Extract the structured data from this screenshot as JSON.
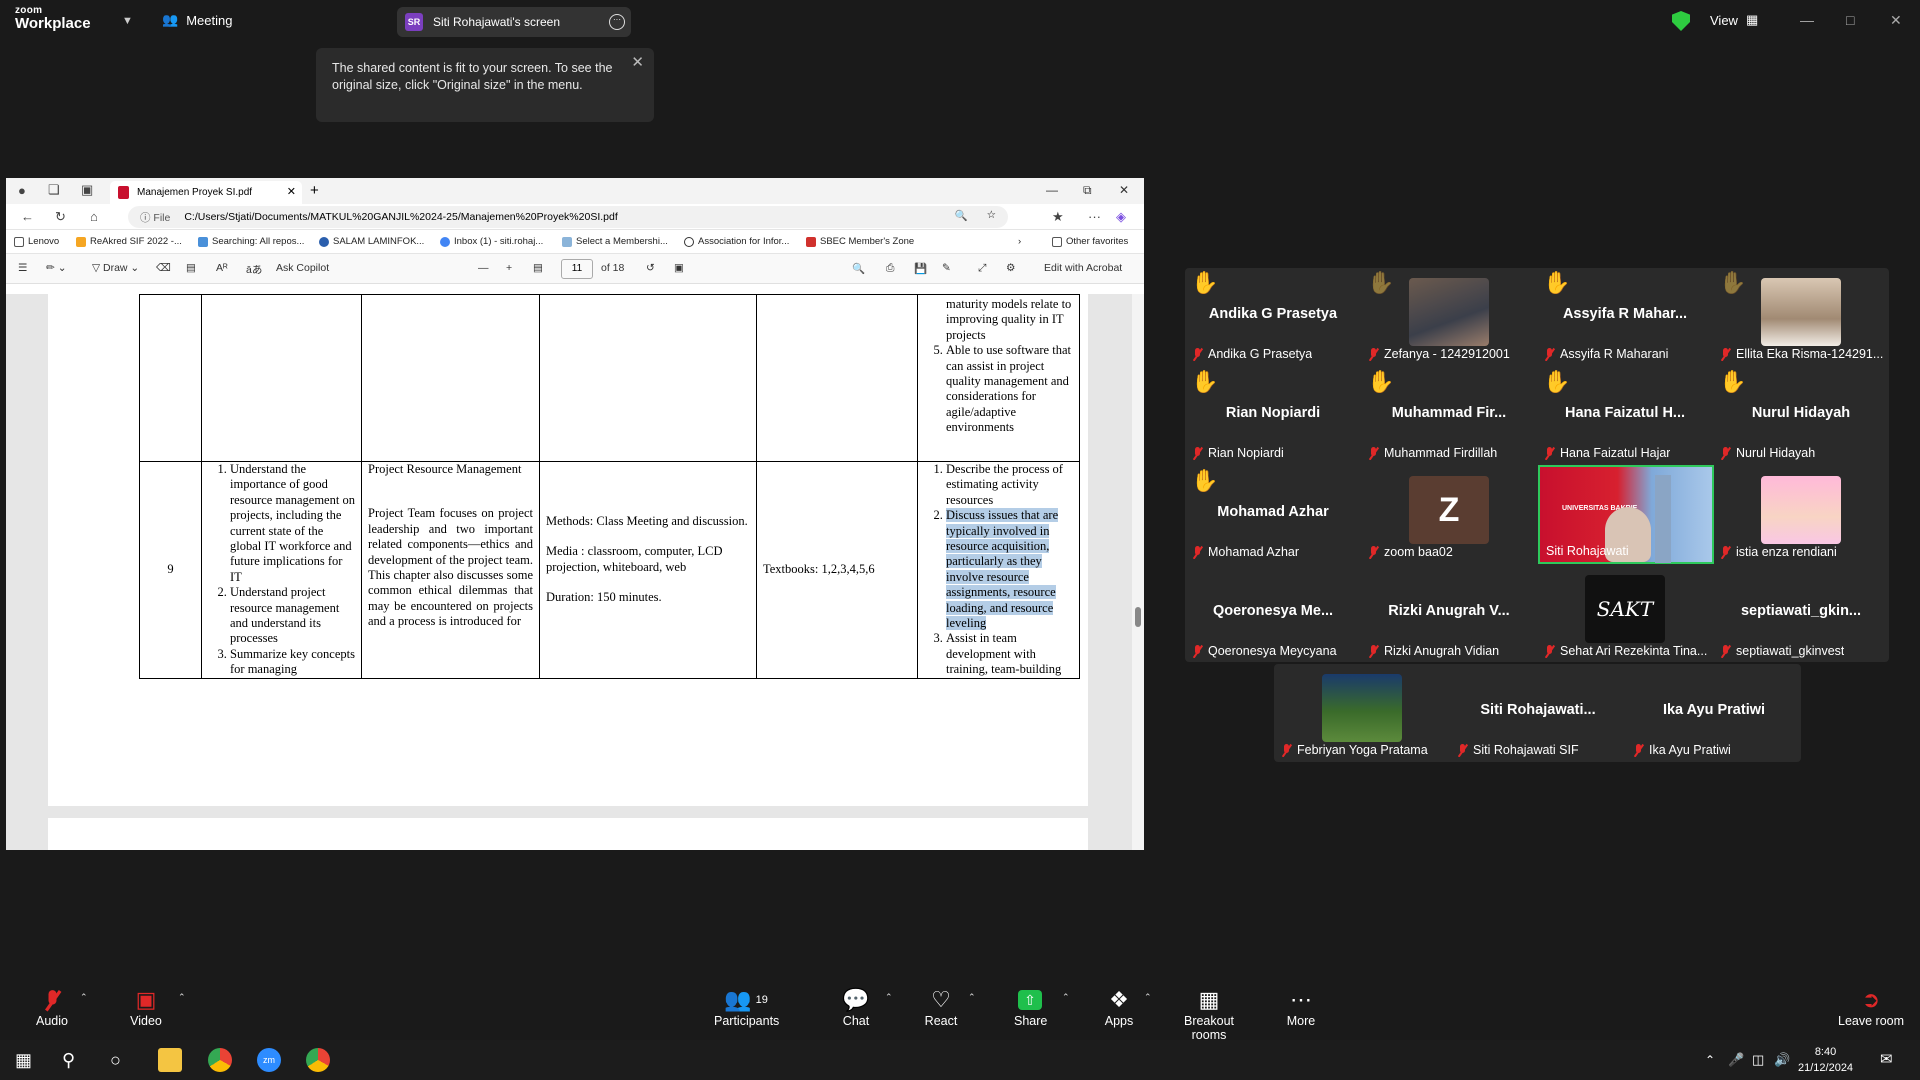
{
  "zoom": {
    "logo_top": "zoom",
    "logo_bottom": "Workplace",
    "meeting_label": "Meeting",
    "share_badge": "SR",
    "share_title": "Siti Rohajawati's screen",
    "view_label": "View",
    "tooltip": "The shared content is fit to your screen. To see the original size, click \"Original size\" in the menu."
  },
  "browser": {
    "tab_title": "Manajemen Proyek SI.pdf",
    "address_prefix": "File",
    "address": "C:/Users/Stjati/Documents/MATKUL%20GANJIL%2024-25/Manajemen%20Proyek%20SI.pdf",
    "favorites": [
      "Lenovo",
      "ReAkred SIF 2022 -...",
      "Searching: All repos...",
      "SALAM LAMINFOK...",
      "Inbox (1) - siti.rohaj...",
      "Select a Membershi...",
      "Association for Infor...",
      "SBEC Member's Zone"
    ],
    "other_favorites": "Other favorites",
    "pdf_toolbar": {
      "draw": "Draw",
      "copilot": "Ask Copilot",
      "page": "11",
      "of": "of 18",
      "acrobat": "Edit with Acrobat"
    }
  },
  "document": {
    "row_top": {
      "items": [
        "maturity models relate to improving quality in IT projects",
        "Able to use software that can assist in project quality management and considerations for agile/adaptive environments"
      ]
    },
    "row_main": {
      "no": "9",
      "objectives": [
        "Understand the importance of good resource management on projects, including the current state of the global IT workforce and future implications for IT",
        "Understand project resource management and understand its processes",
        "Summarize key concepts for managing"
      ],
      "topic_title": "Project Resource Management",
      "topic_desc": "Project Team focuses on project leadership and two important related components—ethics and development of the project team. This chapter also discusses some common ethical dilemmas that may be encountered on projects and a process is introduced for",
      "methods": "Methods: Class Meeting and discussion.",
      "media": "Media : classroom, computer, LCD projection, whiteboard, web",
      "duration": "Duration: 150 minutes.",
      "textbooks": "Textbooks: 1,2,3,4,5,6",
      "outcome_1": "Describe the process of estimating activity resources",
      "outcome_2": "Discuss issues that are typically involved in resource acquisition, particularly as they involve resource assignments, resource loading, and resource leveling",
      "outcome_3": "Assist in team development with training, team-building"
    }
  },
  "participants": [
    {
      "display": "Andika G Prasetya",
      "label": "Andika G Prasetya",
      "hand": true
    },
    {
      "display": "",
      "label": "Zefanya - 1242912001",
      "hand": true,
      "dim": true
    },
    {
      "display": "Assyifa R Mahar...",
      "label": "Assyifa R Maharani",
      "hand": true
    },
    {
      "display": "",
      "label": "Ellita Eka Risma-124291...",
      "hand": true,
      "dim": true
    },
    {
      "display": "Rian Nopiardi",
      "label": "Rian Nopiardi",
      "hand": true
    },
    {
      "display": "Muhammad Fir...",
      "label": "Muhammad Firdillah",
      "hand": true
    },
    {
      "display": "Hana Faizatul H...",
      "label": "Hana Faizatul Hajar",
      "hand": true
    },
    {
      "display": "Nurul Hidayah",
      "label": "Nurul Hidayah",
      "hand": true
    },
    {
      "display": "Mohamad Azhar",
      "label": "Mohamad Azhar",
      "hand": true
    },
    {
      "display": "Z",
      "label": "zoom baa02"
    },
    {
      "display": "",
      "label": "Siti Rohajawati"
    },
    {
      "display": "",
      "label": "istia enza rendiani"
    },
    {
      "display": "Qoeronesya Me...",
      "label": "Qoeronesya Meycyana"
    },
    {
      "display": "Rizki Anugrah V...",
      "label": "Rizki Anugrah Vidian"
    },
    {
      "display": "SAKT",
      "label": "Sehat Ari Rezekinta Tina..."
    },
    {
      "display": "septiawati_gkin...",
      "label": "septiawati_gkinvest"
    },
    {
      "display": "",
      "label": "Febriyan Yoga Pratama"
    },
    {
      "display": "Siti Rohajawati...",
      "label": "Siti Rohajawati SIF"
    },
    {
      "display": "Ika Ayu Pratiwi",
      "label": "Ika Ayu Pratiwi"
    }
  ],
  "video_siti": {
    "banner": "UNIVERSITAS BAKRIE"
  },
  "controls": {
    "audio": "Audio",
    "video": "Video",
    "participants": "Participants",
    "participants_count": "19",
    "chat": "Chat",
    "react": "React",
    "share": "Share",
    "apps": "Apps",
    "breakout": "Breakout rooms",
    "more": "More",
    "leave": "Leave room"
  },
  "taskbar": {
    "time": "8:40",
    "date": "21/12/2024"
  }
}
